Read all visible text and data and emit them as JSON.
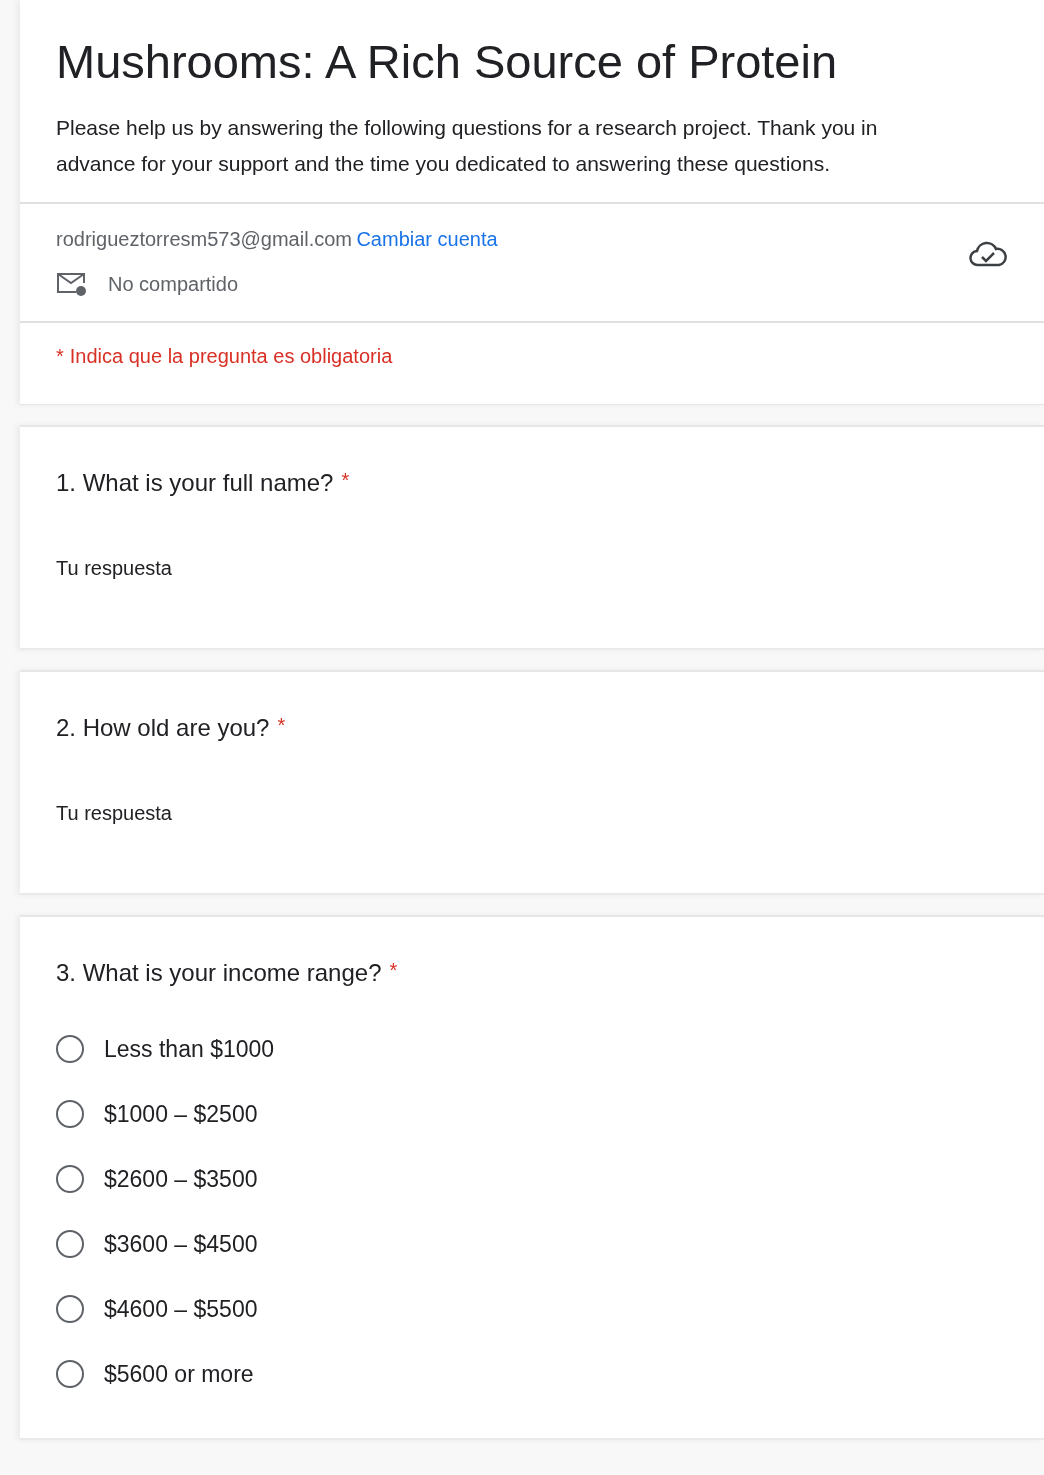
{
  "form": {
    "title": "Mushrooms: A Rich Source of Protein",
    "description": "Please help us by answering the following questions for a research project. Thank you in advance for your support and the time you dedicated to answering these questions."
  },
  "account": {
    "email": "rodrigueztorresm573@gmail.com",
    "switch_link": "Cambiar cuenta",
    "sharing": "No compartido"
  },
  "required_note": {
    "mark": "*",
    "text": "Indica que la pregunta es obligatoria"
  },
  "questions": [
    {
      "kind": "text",
      "title": "1. What is your full name?",
      "required": true,
      "placeholder": "Tu respuesta"
    },
    {
      "kind": "text",
      "title": "2. How old are you?",
      "required": true,
      "placeholder": "Tu respuesta"
    },
    {
      "kind": "radio",
      "title": "3. What is your income range?",
      "required": true,
      "options": [
        {
          "label": "Less than $1000",
          "selected": false
        },
        {
          "label": "$1000 – $2500",
          "selected": false
        },
        {
          "label": "$2600 – $3500",
          "selected": false
        },
        {
          "label": "$3600 – $4500",
          "selected": false
        },
        {
          "label": "$4600 – $5500",
          "selected": false
        },
        {
          "label": "$5600 or more",
          "selected": false
        }
      ]
    }
  ]
}
